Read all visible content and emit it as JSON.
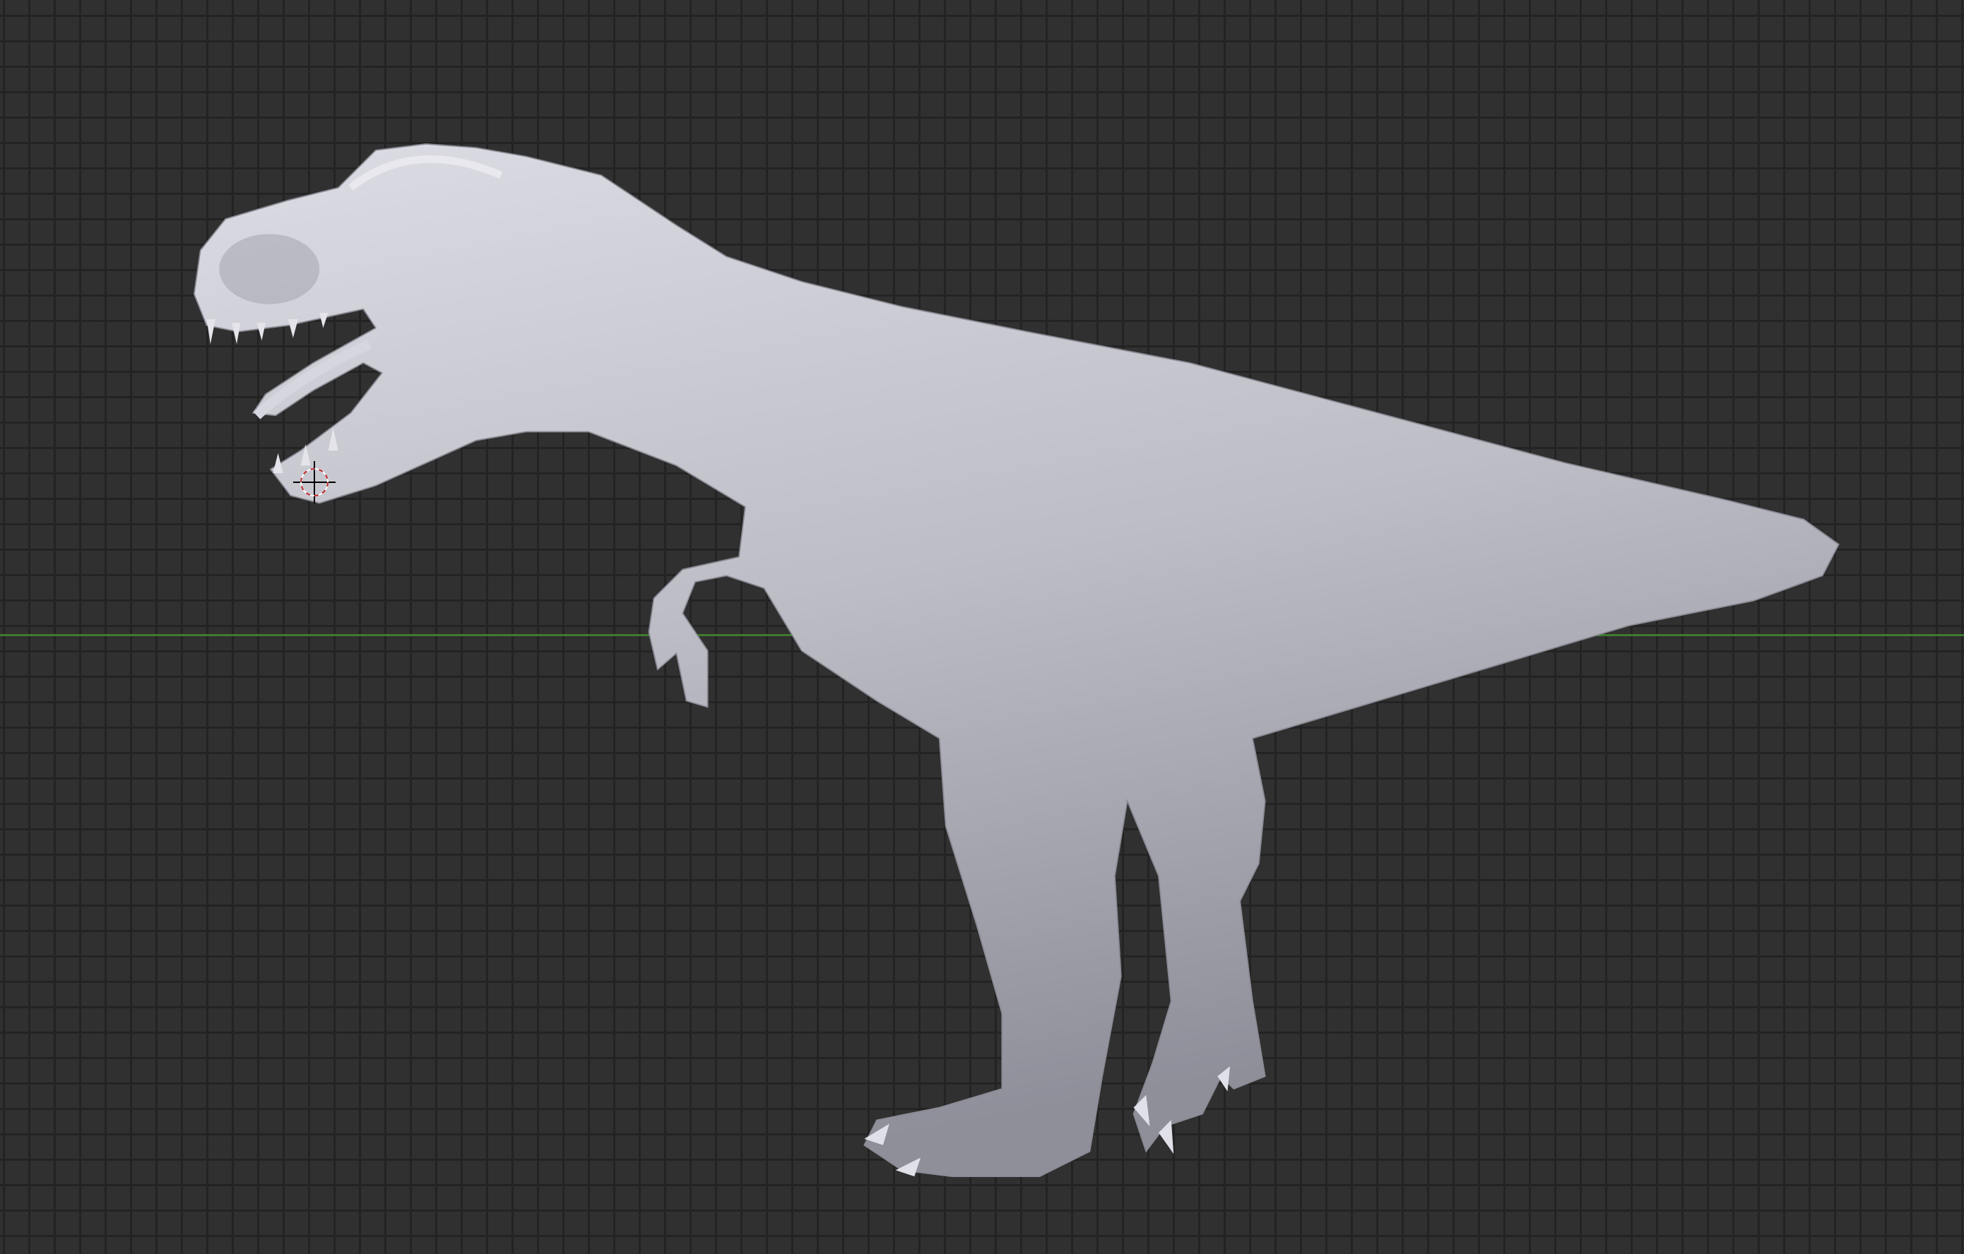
{
  "viewport": {
    "background_color": "#303030",
    "grid_color": "#232323",
    "x_axis_color": "#3f7a2e",
    "model_color": "#c4c4cc",
    "cursor_colors": [
      "#c0282a",
      "#ffffff",
      "#000000"
    ]
  }
}
